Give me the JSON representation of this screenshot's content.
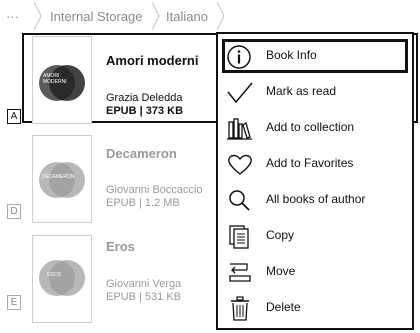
{
  "breadcrumb": {
    "more": "···",
    "items": [
      "Internal Storage",
      "Italiano"
    ]
  },
  "books": [
    {
      "letter": "A",
      "cover_title": "AMORI\nMODERNI",
      "title": "Amori moderni",
      "author": "Grazia Deledda",
      "meta": "EPUB | 373 KB"
    },
    {
      "letter": "D",
      "cover_title": "DECAMERON",
      "title": "Decameron",
      "author": "Giovanni Boccaccio",
      "meta": "EPUB | 1.2 MB"
    },
    {
      "letter": "E",
      "cover_title": "EROS",
      "title": "Eros",
      "author": "Giovanni Verga",
      "meta": "EPUB | 531 KB"
    }
  ],
  "menu": {
    "items": [
      {
        "label": "Book Info",
        "icon": "info-icon"
      },
      {
        "label": "Mark as read",
        "icon": "checkmark-icon"
      },
      {
        "label": "Add to collection",
        "icon": "bookshelf-icon"
      },
      {
        "label": "Add to Favorites",
        "icon": "heart-icon"
      },
      {
        "label": "All books of author",
        "icon": "search-icon"
      },
      {
        "label": "Copy",
        "icon": "copy-icon"
      },
      {
        "label": "Move",
        "icon": "move-icon"
      },
      {
        "label": "Delete",
        "icon": "trash-icon"
      }
    ]
  }
}
